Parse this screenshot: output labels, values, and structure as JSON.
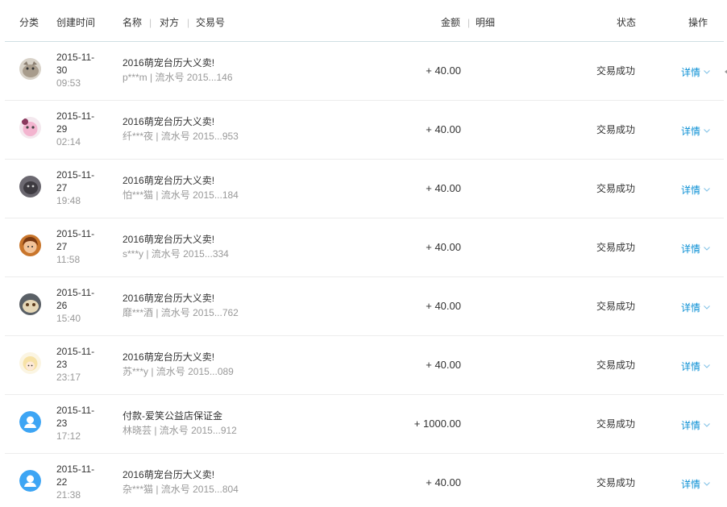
{
  "header": {
    "category": "分类",
    "created": "创建时间",
    "name": "名称",
    "sep": "|",
    "counterparty": "对方",
    "txn_no": "交易号",
    "amount": "金额",
    "detail": "明细",
    "status": "状态",
    "action": "操作"
  },
  "rows": [
    {
      "date": "2015-11-",
      "day": "30",
      "time": "09:53",
      "name": "2016萌宠台历大义卖!",
      "meta": "p***m | 流水号 2015...146",
      "amount": "+ 40.00",
      "status": "交易成功",
      "action": "详情",
      "avatar": "cat-gray"
    },
    {
      "date": "2015-11-",
      "day": "29",
      "time": "02:14",
      "name": "2016萌宠台历大义卖!",
      "meta": "纤***夜 | 流水号 2015...953",
      "amount": "+ 40.00",
      "status": "交易成功",
      "action": "详情",
      "avatar": "pink-cartoon"
    },
    {
      "date": "2015-11-",
      "day": "27",
      "time": "19:48",
      "name": "2016萌宠台历大义卖!",
      "meta": "怕***猫 | 流水号 2015...184",
      "amount": "+ 40.00",
      "status": "交易成功",
      "action": "详情",
      "avatar": "dark-cat"
    },
    {
      "date": "2015-11-",
      "day": "27",
      "time": "11:58",
      "name": "2016萌宠台历大义卖!",
      "meta": "s***y | 流水号 2015...334",
      "amount": "+ 40.00",
      "status": "交易成功",
      "action": "详情",
      "avatar": "girl-face"
    },
    {
      "date": "2015-11-",
      "day": "26",
      "time": "15:40",
      "name": "2016萌宠台历大义卖!",
      "meta": "靡***酒 | 流水号 2015...762",
      "amount": "+ 40.00",
      "status": "交易成功",
      "action": "详情",
      "avatar": "cartoon-gray"
    },
    {
      "date": "2015-11-",
      "day": "23",
      "time": "23:17",
      "name": "2016萌宠台历大义卖!",
      "meta": "苏***y | 流水号 2015...089",
      "amount": "+ 40.00",
      "status": "交易成功",
      "action": "详情",
      "avatar": "anime-blonde"
    },
    {
      "date": "2015-11-",
      "day": "23",
      "time": "17:12",
      "name": "付款-爱笑公益店保证金",
      "meta": "林晓芸 | 流水号 2015...912",
      "amount": "+ 1000.00",
      "status": "交易成功",
      "action": "详情",
      "avatar": "default-user"
    },
    {
      "date": "2015-11-",
      "day": "22",
      "time": "21:38",
      "name": "2016萌宠台历大义卖!",
      "meta": "杂***猫 | 流水号 2015...804",
      "amount": "+ 40.00",
      "status": "交易成功",
      "action": "详情",
      "avatar": "default-user"
    }
  ],
  "colors": {
    "link": "#0a8fd4",
    "muted": "#999999",
    "text": "#333333",
    "avatar_default": "#3da5f4"
  }
}
